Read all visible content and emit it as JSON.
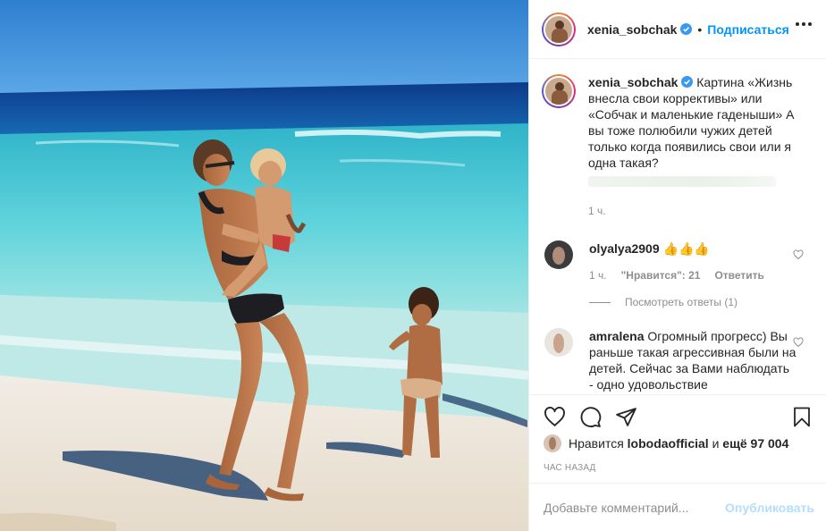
{
  "post": {
    "username": "xenia_sobchak",
    "follow_label": "Подписаться",
    "separator": "•"
  },
  "caption": {
    "username": "xenia_sobchak",
    "text": "Картина «Жизнь внесла свои коррективы» или «Собчак и маленькие гаденыши» А вы тоже полюбили чужих детей только когда появились свои или я одна такая?",
    "time": "1 ч."
  },
  "comments": [
    {
      "username": "olyalya2909",
      "text": "👍👍👍",
      "time": "1 ч.",
      "likes": "\"Нравится\": 21",
      "reply_label": "Ответить",
      "view_replies": "Посмотреть ответы (1)"
    },
    {
      "username": "amralena",
      "text": "Огромный прогресс) Вы раньше такая агрессивная были на детей. Сейчас за Вами наблюдать - одно удовольствие"
    }
  ],
  "likes_line": {
    "prefix": "Нравится",
    "user": "lobodaofficial",
    "middle": "и",
    "rest": "ещё 97 004"
  },
  "posted_ago": "ЧАС НАЗАД",
  "add_comment": {
    "placeholder": "Добавьте комментарий...",
    "publish_label": "Опубликовать"
  },
  "icons": {
    "verified": "verified-badge-icon",
    "more": "more-options-icon",
    "like": "heart-icon",
    "comment": "comment-icon",
    "share": "paper-plane-icon",
    "save": "bookmark-icon"
  },
  "colors": {
    "link_blue": "#0095f6",
    "publish_disabled": "#b2dffc",
    "muted": "#8e8e8e",
    "text": "#262626"
  }
}
